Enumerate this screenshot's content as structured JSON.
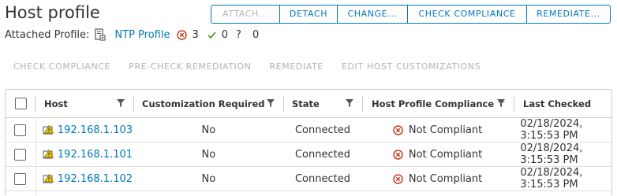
{
  "title": "Host profile",
  "top_actions": [
    {
      "label": "ATTACH...",
      "disabled": true
    },
    {
      "label": "DETACH",
      "disabled": false
    },
    {
      "label": "CHANGE...",
      "disabled": false
    },
    {
      "label": "CHECK COMPLIANCE",
      "disabled": false
    },
    {
      "label": "REMEDIATE...",
      "disabled": false
    }
  ],
  "attached": {
    "label": "Attached Profile:",
    "profile_name": "NTP Profile",
    "error_count": "3",
    "ok_count": "0",
    "unknown_symbol": "?",
    "unknown_count": "0"
  },
  "toolbar": [
    "CHECK COMPLIANCE",
    "PRE-CHECK REMEDIATION",
    "REMEDIATE",
    "EDIT HOST CUSTOMIZATIONS"
  ],
  "columns": [
    "Host",
    "Customization Required",
    "State",
    "Host Profile Compliance",
    "Last Checked"
  ],
  "rows": [
    {
      "host": "192.168.1.103",
      "customization": "No",
      "state": "Connected",
      "compliance": "Not Compliant",
      "last_checked": "02/18/2024, 3:15:53 PM"
    },
    {
      "host": "192.168.1.101",
      "customization": "No",
      "state": "Connected",
      "compliance": "Not Compliant",
      "last_checked": "02/18/2024, 3:15:53 PM"
    },
    {
      "host": "192.168.1.102",
      "customization": "No",
      "state": "Connected",
      "compliance": "Not Compliant",
      "last_checked": "02/18/2024, 3:15:53 PM"
    }
  ],
  "colors": {
    "accent": "#0079b8",
    "error": "#c92100",
    "warning": "#f2c500"
  }
}
